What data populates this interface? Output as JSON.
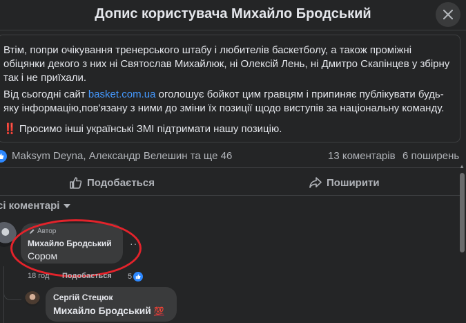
{
  "header": {
    "title": "Допис користувача Михайло Бродський"
  },
  "post": {
    "paragraph1": "Втім, попри очікування тренерського штабу і любителів баскетболу,  а також проміжні обіцянки декого з них ні Святослав Михайлюк, ні Олексій Лень, ні Дмитро Скапінцев у збірну так і не приїхали.",
    "paragraph2_before": "Від сьогодні сайт ",
    "paragraph2_link": "basket.com.ua",
    "paragraph2_after": " оголошує бойкот цим гравцям і припиняє публікувати будь-яку інформацію,пов'язану з ними до зміни їх позиції щодо виступів за національну команду.",
    "paragraph3_emoji": "‼️",
    "paragraph3": " Просимо інші українські ЗМІ підтримати нашу позицію."
  },
  "stats": {
    "reactions_text": "Maksym Deyna, Александр Велешин та ще 46",
    "comments": "13 коментарів",
    "shares": "6 поширень"
  },
  "actions": {
    "like": "Подобається",
    "share": "Поширити"
  },
  "sort": {
    "label": "сі коментарі"
  },
  "comments": [
    {
      "badge": "Автор",
      "name": "Михайло Бродський",
      "text": "Сором",
      "time": "18 год",
      "like_label": "Подобається",
      "like_count": "5"
    },
    {
      "name": "Сергій Стецюк",
      "text": "Михайло Бродський",
      "emoji": "💯"
    }
  ],
  "colors": {
    "background": "#242526",
    "bubble": "#3a3b3c",
    "link": "#4599ff",
    "like_blue": "#2d88ff",
    "highlight_ring": "#e3232b"
  }
}
